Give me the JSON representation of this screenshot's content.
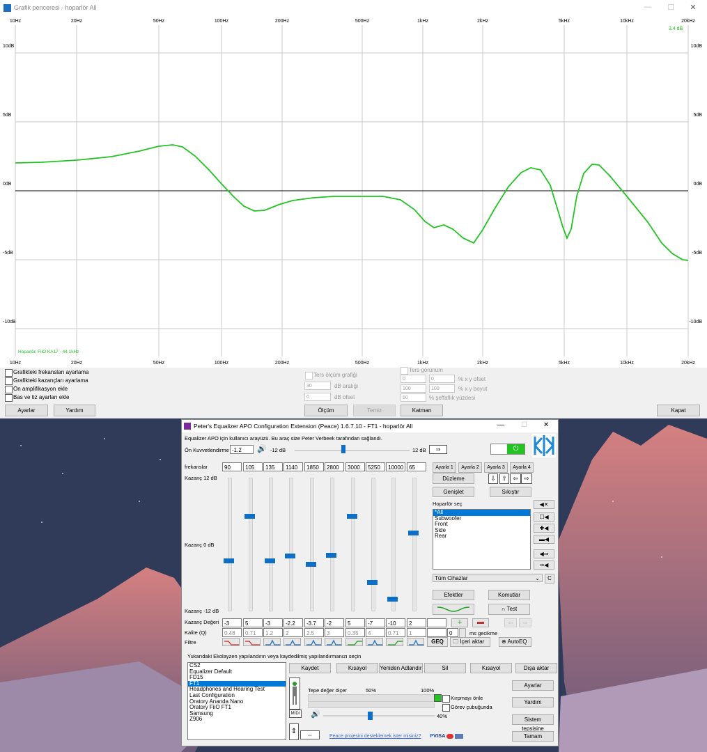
{
  "graph_window": {
    "title": "Grafik penceresi - hoparlör All",
    "freq_labels": [
      "10Hz",
      "20Hz",
      "50Hz",
      "100Hz",
      "200Hz",
      "500Hz",
      "1kHz",
      "2kHz",
      "5kHz",
      "10kHz",
      "20kHz"
    ],
    "db_labels": [
      "10dB",
      "5dB",
      "0dB",
      "-5dB",
      "-10dB"
    ],
    "max_readout": "3.4 dB",
    "device_label": "Hoparlör, FiiO KA17 - 44.1kHz",
    "curve_color": "#22c322",
    "checkboxes": [
      "Grafikteki frekansları ayarlama",
      "Grafikteki kazançları ayarlama",
      "Ön amplifikasyon ekle",
      "Bas ve tiz ayarları ekle"
    ],
    "ters_olcum": "Ters ölçüm grafiği",
    "db_aralik_value": "30",
    "db_aralik_label": "dB aralığı",
    "db_ofset_value": "0",
    "db_ofset_label": "dB ofset",
    "ters_gorunum": "Ters görünüm",
    "x_ofset_value": "0",
    "y_ofset_value": "0",
    "xy_ofset_label": "% x y ofset",
    "x_boyut_value": "100",
    "y_boyut_value": "100",
    "xy_boyut_label": "% x y boyut",
    "seffaflik_value": "50",
    "seffaflik_label": "% şeffaflık yüzdesi",
    "buttons": {
      "ayarlar": "Ayarlar",
      "yardim": "Yardım",
      "olcum": "Ölçüm",
      "temiz": "Temiz",
      "katman": "Katman",
      "kapat": "Kapat"
    },
    "close_glyph": "✕"
  },
  "peace_window": {
    "title": "Peter's Equalizer APO Configuration Extension (Peace) 1.6.7.10 - FT1 - hoparlör All",
    "subtitle": "Equalizer APO için kullanıcı arayüzü. Bu araç size Peter Verbeek tarafından sağlandı.",
    "preamp_label": "Ön Kuvvetlendirme",
    "preamp_value": "-1.2",
    "preamp_min": "-12 dB",
    "preamp_max": "12 dB",
    "freq_label": "frekanslar",
    "freqs": [
      "90",
      "105",
      "135",
      "1140",
      "1850",
      "2800",
      "3000",
      "5250",
      "10000",
      "65"
    ],
    "gain_top": "Kazanç 12 dB",
    "gain_mid": "Kazanç 0 dB",
    "gain_bottom": "Kazanç -12 dB",
    "gain_values_label": "Kazanç Değeri",
    "gains": [
      "-3",
      "5",
      "-3",
      "-2.2",
      "-3.7",
      "-2",
      "5",
      "-7",
      "-10",
      "2"
    ],
    "quality_label": "Kalite (Q)",
    "qualities": [
      "0.48",
      "0.71",
      "1.2",
      "2",
      "2.5",
      "3",
      "0.35",
      "4",
      "0.71",
      "1"
    ],
    "filter_label": "Filtre",
    "delay_value": "0",
    "delay_label": "ms gecikme",
    "setting_buttons": [
      "Ayarla 1",
      "Ayarla 2",
      "Ayarla 3",
      "Ayarla 4"
    ],
    "duzleme": "Düzleme",
    "genislet": "Genişlet",
    "sikistir": "Sıkıştır",
    "hoparlor_sec": "Hoparlör seç",
    "speakers": [
      "*All",
      "Subwoofer",
      "Front",
      "Side",
      "Rear"
    ],
    "devices": "Tüm Cihazlar",
    "c_button": "C",
    "efektler": "Efektler",
    "komutlar": "Komutlar",
    "test": "Test",
    "geq": "GEQ",
    "iceri_aktar": "İçeri aktar",
    "autoeq": "AutoEQ",
    "configs_label": "Yukarıdaki Ekolayzen  yapılandırın veya kaydedilmiş yapılandırmanızı seçin",
    "configs": [
      "CS2",
      "Equalizer Default",
      "FD15",
      "FT1",
      "Headphones and Hearing Test",
      "Last Configuration",
      "Oratory Ananda Nano",
      "Oratory FiiO  FT1",
      "Samsung",
      "Z906"
    ],
    "selected_config": "FT1",
    "action_buttons": [
      "Kaydet",
      "Kısayol",
      "Yeniden Adlandır",
      "Sil",
      "Kısayol",
      "Dışa aktar"
    ],
    "side_buttons": [
      "Ayarlar",
      "Yardım",
      "Sistem tepsisine",
      "Tamam"
    ],
    "peak_meter": "Tepe değer ölçer",
    "peak_50": "50%",
    "peak_100": "100%",
    "kirpma": "Kırpmayı önle",
    "gorev": "Görev çubuğunda",
    "volume": "40%",
    "volume_fraction": 0.4,
    "midi": "MIDI",
    "donate": "Peace projesini desteklemek ister misiniz?",
    "visa": "VISA",
    "power_color": "#22c322",
    "accent": "#0f6fc6"
  }
}
